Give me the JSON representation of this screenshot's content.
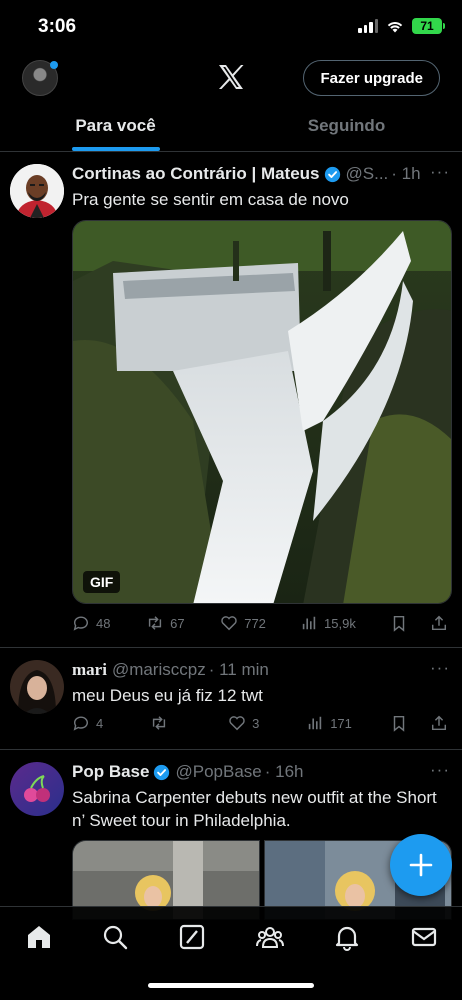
{
  "status_bar": {
    "time": "3:06",
    "battery": "71"
  },
  "header": {
    "upgrade_label": "Fazer upgrade"
  },
  "tabs": [
    {
      "label": "Para você",
      "active": true
    },
    {
      "label": "Seguindo",
      "active": false
    }
  ],
  "tweets": [
    {
      "name": "Cortinas ao Contrário | Mateus",
      "verified": true,
      "handle": "@S...",
      "time": "· 1h",
      "text": "Pra gente se sentir em casa de novo",
      "media_badge": "GIF",
      "stats": {
        "replies": "48",
        "retweets": "67",
        "likes": "772",
        "views": "15,9k"
      }
    },
    {
      "name": "mari",
      "verified": false,
      "handle": "@marisccpz",
      "time": "· 11 min",
      "text": "meu Deus eu já fiz 12 twt",
      "stats": {
        "replies": "4",
        "retweets": "",
        "likes": "3",
        "views": "171"
      }
    },
    {
      "name": "Pop Base",
      "verified": true,
      "handle": "@PopBase",
      "time": "· 16h",
      "text": "Sabrina Carpenter debuts new outfit at the Short n’ Sweet tour in Philadelphia."
    }
  ],
  "more_glyph": "···",
  "colors": {
    "accent": "#1d9bf0",
    "battery": "#32d74b",
    "divider": "#2f3336",
    "muted": "#71767b"
  },
  "nav_icons": [
    "home-icon",
    "search-icon",
    "grok-icon",
    "communities-icon",
    "notifications-icon",
    "messages-icon"
  ]
}
